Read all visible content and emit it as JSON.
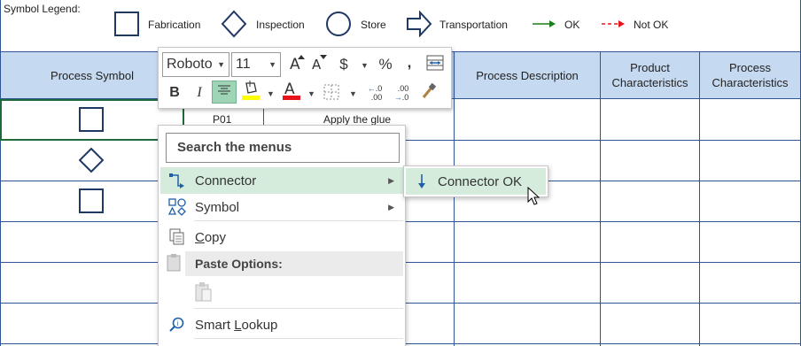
{
  "legend": {
    "title": "Symbol Legend:",
    "items": [
      {
        "label": "Fabrication",
        "icon": "square-icon"
      },
      {
        "label": "Inspection",
        "icon": "diamond-icon"
      },
      {
        "label": "Store",
        "icon": "circle-icon"
      },
      {
        "label": "Transportation",
        "icon": "arrow-outline-icon"
      },
      {
        "label": "OK",
        "icon": "green-arrow-icon",
        "color": "#1a7f1a"
      },
      {
        "label": "Not OK",
        "icon": "red-dashed-arrow-icon",
        "color": "#e8141c"
      }
    ]
  },
  "table": {
    "headers": [
      "Process Symbol",
      "Process Description",
      "Product Characteristics",
      "Process Characteristics"
    ],
    "rows": [
      {
        "symbol": "square-icon",
        "step": "P01",
        "description": "Apply the glue"
      },
      {
        "symbol": "diamond-icon",
        "step": "",
        "description": ""
      },
      {
        "symbol": "square-icon",
        "step": "",
        "description": ""
      }
    ]
  },
  "mini_toolbar": {
    "font_name": "Roboto",
    "font_size": "11",
    "currency": "$",
    "percent": "%",
    "comma": ",",
    "bold": "B",
    "italic": "I",
    "font_color_letter": "A",
    "decrease_decimal": ".00",
    "increase_decimal": ".0"
  },
  "context_menu": {
    "search_placeholder": "Search the menus",
    "items": [
      {
        "label": "Connector",
        "has_submenu": true,
        "highlighted": true
      },
      {
        "label": "Symbol",
        "has_submenu": true
      },
      {
        "label_pre": "",
        "label_key": "C",
        "label_post": "opy"
      },
      {
        "header": "Paste Options:"
      },
      {
        "label_pre": "Smart ",
        "label_key": "L",
        "label_post": "ookup"
      }
    ]
  },
  "submenu": {
    "items": [
      {
        "label": "Connector OK"
      }
    ]
  },
  "colors": {
    "header_fill": "#c5d9f1",
    "grid_line": "#2f5597",
    "selection": "#1d6b3a",
    "highlight": "#d5ecdd",
    "ok": "#1a7f1a",
    "not_ok": "#e8141c"
  }
}
